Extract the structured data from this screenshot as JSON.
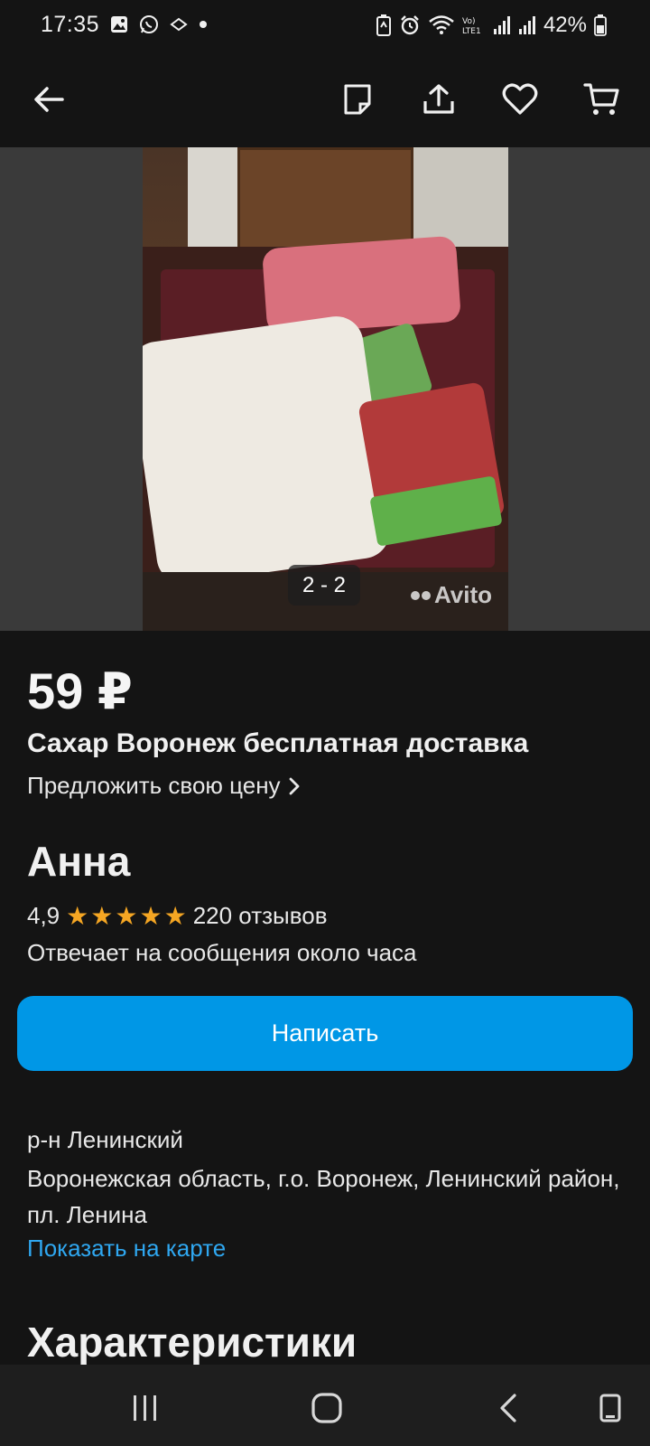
{
  "status_bar": {
    "time": "17:35",
    "battery_percent": "42%",
    "left_icons": [
      "gallery-icon",
      "whatsapp-icon",
      "app-icon",
      "dot-icon"
    ],
    "right_icons": [
      "battery-saver-icon",
      "alarm-icon",
      "wifi-icon",
      "volte-icon",
      "signal-icon",
      "signal-icon",
      "battery-icon"
    ],
    "volte_label": "Vo) LTE1"
  },
  "toolbar": {
    "icons": [
      "back-arrow-icon",
      "note-icon",
      "share-icon",
      "heart-icon",
      "cart-icon"
    ]
  },
  "gallery": {
    "counter": "2 - 2",
    "watermark": "Avito"
  },
  "listing": {
    "price": "59 ₽",
    "title": "Сахар Воронеж бесплатная доставка",
    "offer_price_link": "Предложить свою цену"
  },
  "seller": {
    "name": "Анна",
    "rating": "4,9",
    "stars": 5,
    "reviews": "220 отзывов",
    "response_time": "Отвечает на сообщения около часа",
    "write_button": "Написать"
  },
  "location": {
    "district": "р-н Ленинский",
    "address": "Воронежская область, г.о. Воронеж, Ленинский район, пл. Ленина",
    "map_link": "Показать на карте"
  },
  "sections": {
    "characteristics": "Характеристики"
  },
  "colors": {
    "background": "#141414",
    "accent_button": "#0097e6",
    "link": "#2fa7f0",
    "star": "#f5a623"
  }
}
